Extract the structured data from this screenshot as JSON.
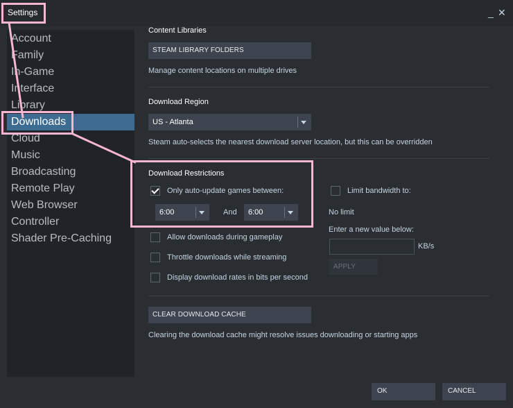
{
  "window": {
    "title": "Settings",
    "minimize_icon": "_",
    "close_icon": "✕"
  },
  "sidebar": {
    "items": [
      {
        "label": "Account"
      },
      {
        "label": "Family"
      },
      {
        "label": "In-Game"
      },
      {
        "label": "Interface"
      },
      {
        "label": "Library"
      },
      {
        "label": "Downloads",
        "active": true
      },
      {
        "label": "Cloud"
      },
      {
        "label": "Music"
      },
      {
        "label": "Broadcasting"
      },
      {
        "label": "Remote Play"
      },
      {
        "label": "Web Browser"
      },
      {
        "label": "Controller"
      },
      {
        "label": "Shader Pre-Caching"
      }
    ]
  },
  "content_libraries": {
    "title": "Content Libraries",
    "button_label": "STEAM LIBRARY FOLDERS",
    "description": "Manage content locations on multiple drives"
  },
  "download_region": {
    "title": "Download Region",
    "selected": "US - Atlanta",
    "description": "Steam auto-selects the nearest download server location, but this can be overridden"
  },
  "download_restrictions": {
    "title": "Download Restrictions",
    "auto_update_label": "Only auto-update games between:",
    "auto_update_checked": true,
    "start_time": "6:00",
    "and_label": "And",
    "end_time": "6:00",
    "limit_bandwidth_label": "Limit bandwidth to:",
    "limit_bandwidth_checked": false,
    "no_limit_text": "No limit",
    "enter_value_label": "Enter a new value below:",
    "bandwidth_value": "",
    "unit_label": "KB/s",
    "apply_label": "APPLY"
  },
  "options": [
    {
      "label": "Allow downloads during gameplay",
      "checked": false
    },
    {
      "label": "Throttle downloads while streaming",
      "checked": false
    },
    {
      "label": "Display download rates in bits per second",
      "checked": false
    }
  ],
  "cache": {
    "button_label": "CLEAR DOWNLOAD CACHE",
    "description": "Clearing the download cache might resolve issues downloading or starting apps"
  },
  "footer": {
    "ok_label": "OK",
    "cancel_label": "CANCEL"
  },
  "colors": {
    "accent_active": "#3e6b91",
    "highlight": "#f9b6d2",
    "button_bg": "#3d4450",
    "panel_bg": "#2a2e33",
    "sidebar_bg": "#202429"
  }
}
